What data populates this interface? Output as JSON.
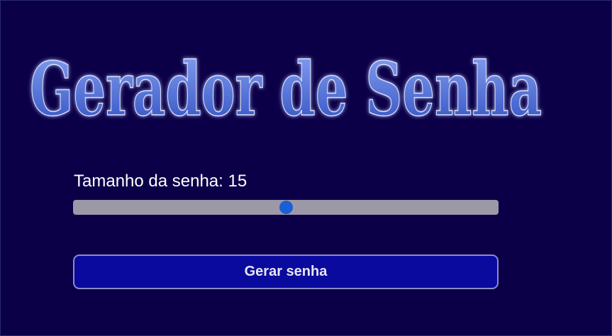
{
  "page": {
    "title": "Gerador de Senha"
  },
  "password_length": {
    "label": "Tamanho da senha: 15",
    "value": 15,
    "slider_fraction": 0.5
  },
  "actions": {
    "generate_label": "Gerar senha"
  },
  "colors": {
    "background": "#0b0048",
    "title_fill_top": "#8aa4f4",
    "title_fill_bottom": "#2f4ec0",
    "slider_track": "#9c98a8",
    "slider_thumb": "#1a5fd6",
    "button_background": "#0a0a9e",
    "button_border": "#8c8cc8"
  }
}
